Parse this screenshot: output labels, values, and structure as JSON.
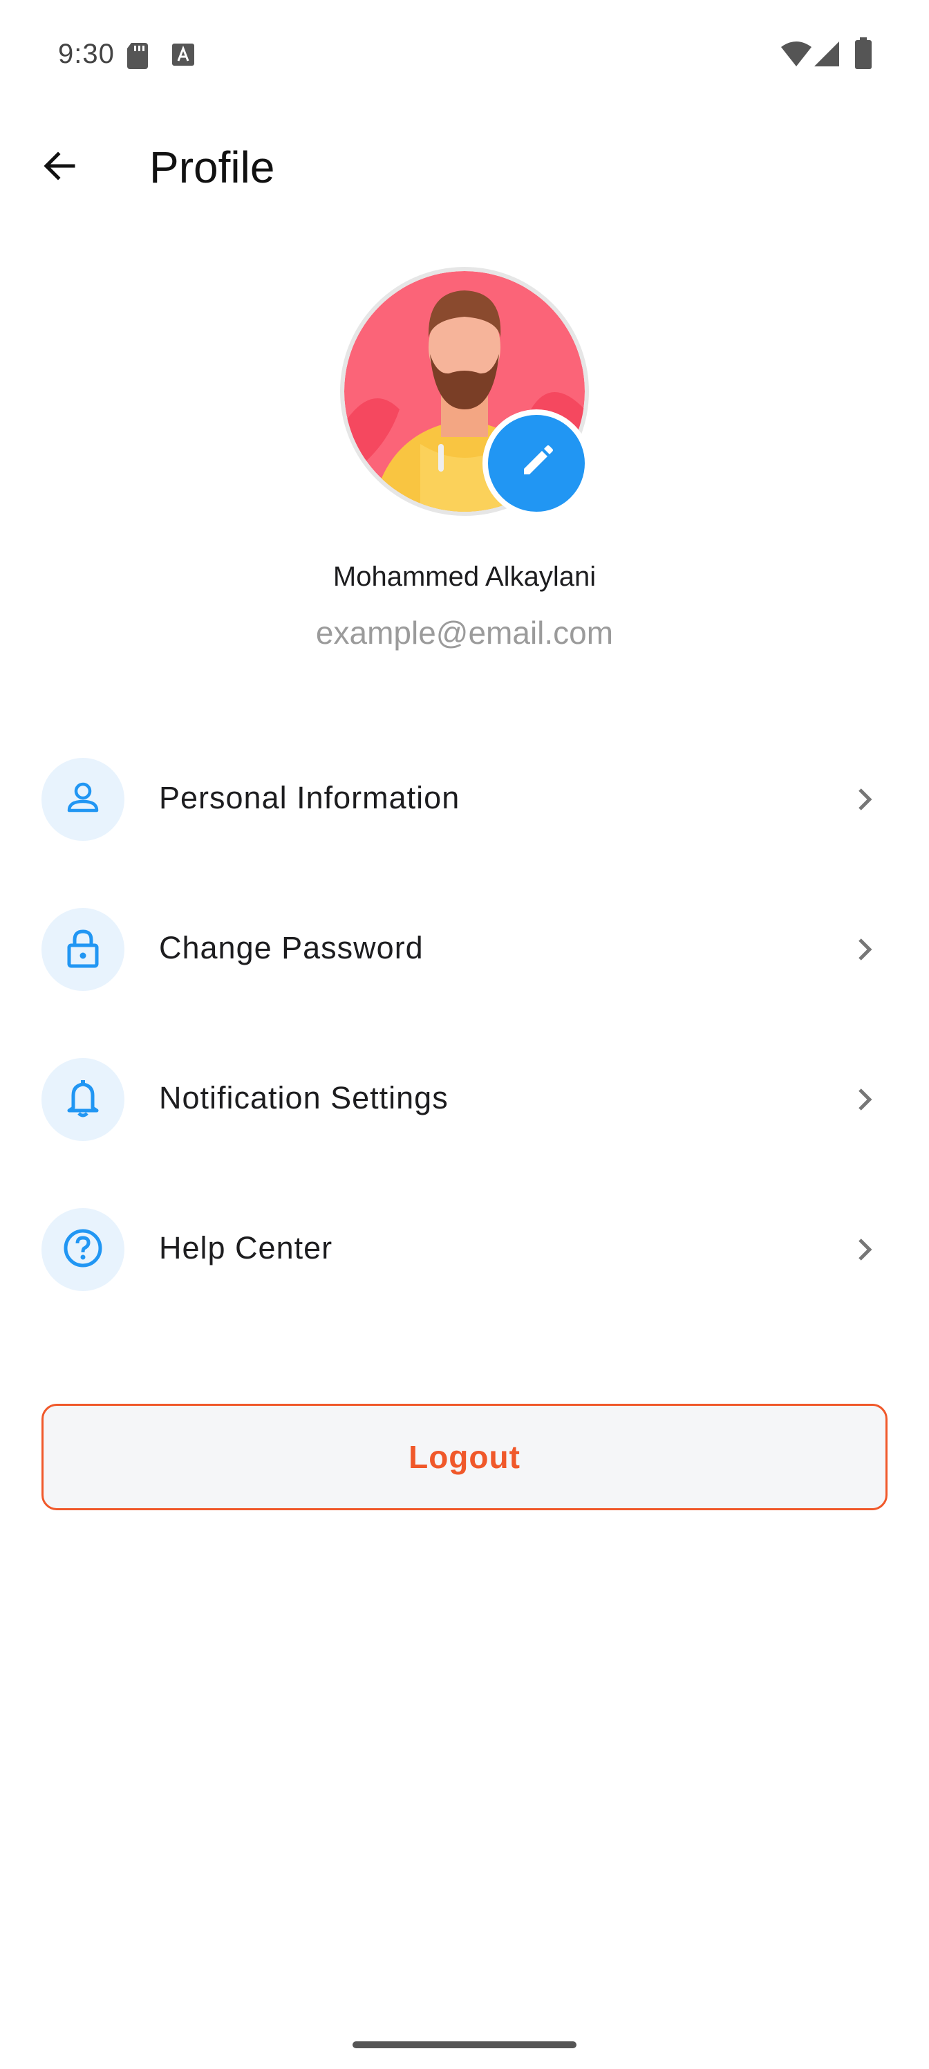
{
  "status_bar": {
    "time": "9:30",
    "icons": [
      "sd-card-icon",
      "keyboard-a-icon",
      "wifi-icon",
      "signal-icon",
      "battery-icon"
    ]
  },
  "app_bar": {
    "title": "Profile",
    "back_icon": "arrow-left-icon"
  },
  "profile": {
    "name": "Mohammed Alkaylani",
    "email": "example@email.com",
    "edit_icon": "pencil-icon"
  },
  "menu": {
    "items": [
      {
        "label": "Personal Information",
        "icon": "person-icon"
      },
      {
        "label": "Change Password",
        "icon": "lock-icon"
      },
      {
        "label": "Notification Settings",
        "icon": "bell-icon"
      },
      {
        "label": "Help Center",
        "icon": "help-circle-icon"
      }
    ]
  },
  "logout": {
    "label": "Logout"
  },
  "colors": {
    "accent": "#2196f3",
    "icon_bg": "#e8f3fd",
    "logout": "#f0582a",
    "email": "#9b9b9b"
  }
}
